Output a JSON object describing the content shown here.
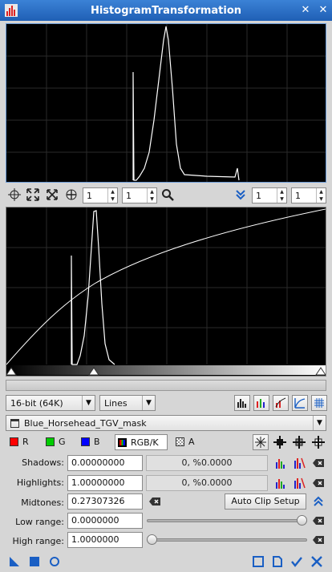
{
  "window": {
    "title": "HistogramTransformation"
  },
  "colors": {
    "title_bar": "#1f5fb5",
    "accent_blue": "#1a5fc4",
    "histogram_bg": "#000000",
    "histogram_line": "#ffffff",
    "red": "#ff0000",
    "green": "#00cc00",
    "blue": "#0000ff"
  },
  "upper_toolbar": {
    "icons": [
      "new-instance-icon",
      "zoom-fit-icon",
      "zoom-reset-icon",
      "pan-icon",
      "zoom-icon",
      "collapse-icon"
    ],
    "zoom_x": "1",
    "zoom_y": "1",
    "zoom_x_right": "1",
    "zoom_y_right": "1"
  },
  "controls": {
    "resolution": "16-bit (64K)",
    "graph_style": "Lines",
    "view": "Blue_Horsehead_TGV_mask"
  },
  "channels": [
    {
      "label": "R",
      "color": "#ff0000",
      "selected": false
    },
    {
      "label": "G",
      "color": "#00cc00",
      "selected": false
    },
    {
      "label": "B",
      "color": "#0000ff",
      "selected": false
    },
    {
      "label": "RGB/K",
      "color": "rgbk",
      "selected": true
    },
    {
      "label": "A",
      "color": "checker",
      "selected": false
    }
  ],
  "params": {
    "shadows": {
      "label": "Shadows:",
      "value": "0.00000000",
      "stat": "0, %0.0000"
    },
    "highlights": {
      "label": "Highlights:",
      "value": "1.00000000",
      "stat": "0, %0.0000"
    },
    "midtones": {
      "label": "Midtones:",
      "value": "0.27307326"
    },
    "auto_clip_label": "Auto Clip Setup",
    "low_range": {
      "label": "Low range:",
      "value": "0.0000000",
      "slider_fraction": 1.0
    },
    "high_range": {
      "label": "High range:",
      "value": "1.0000000",
      "slider_fraction": 0.0
    }
  }
}
